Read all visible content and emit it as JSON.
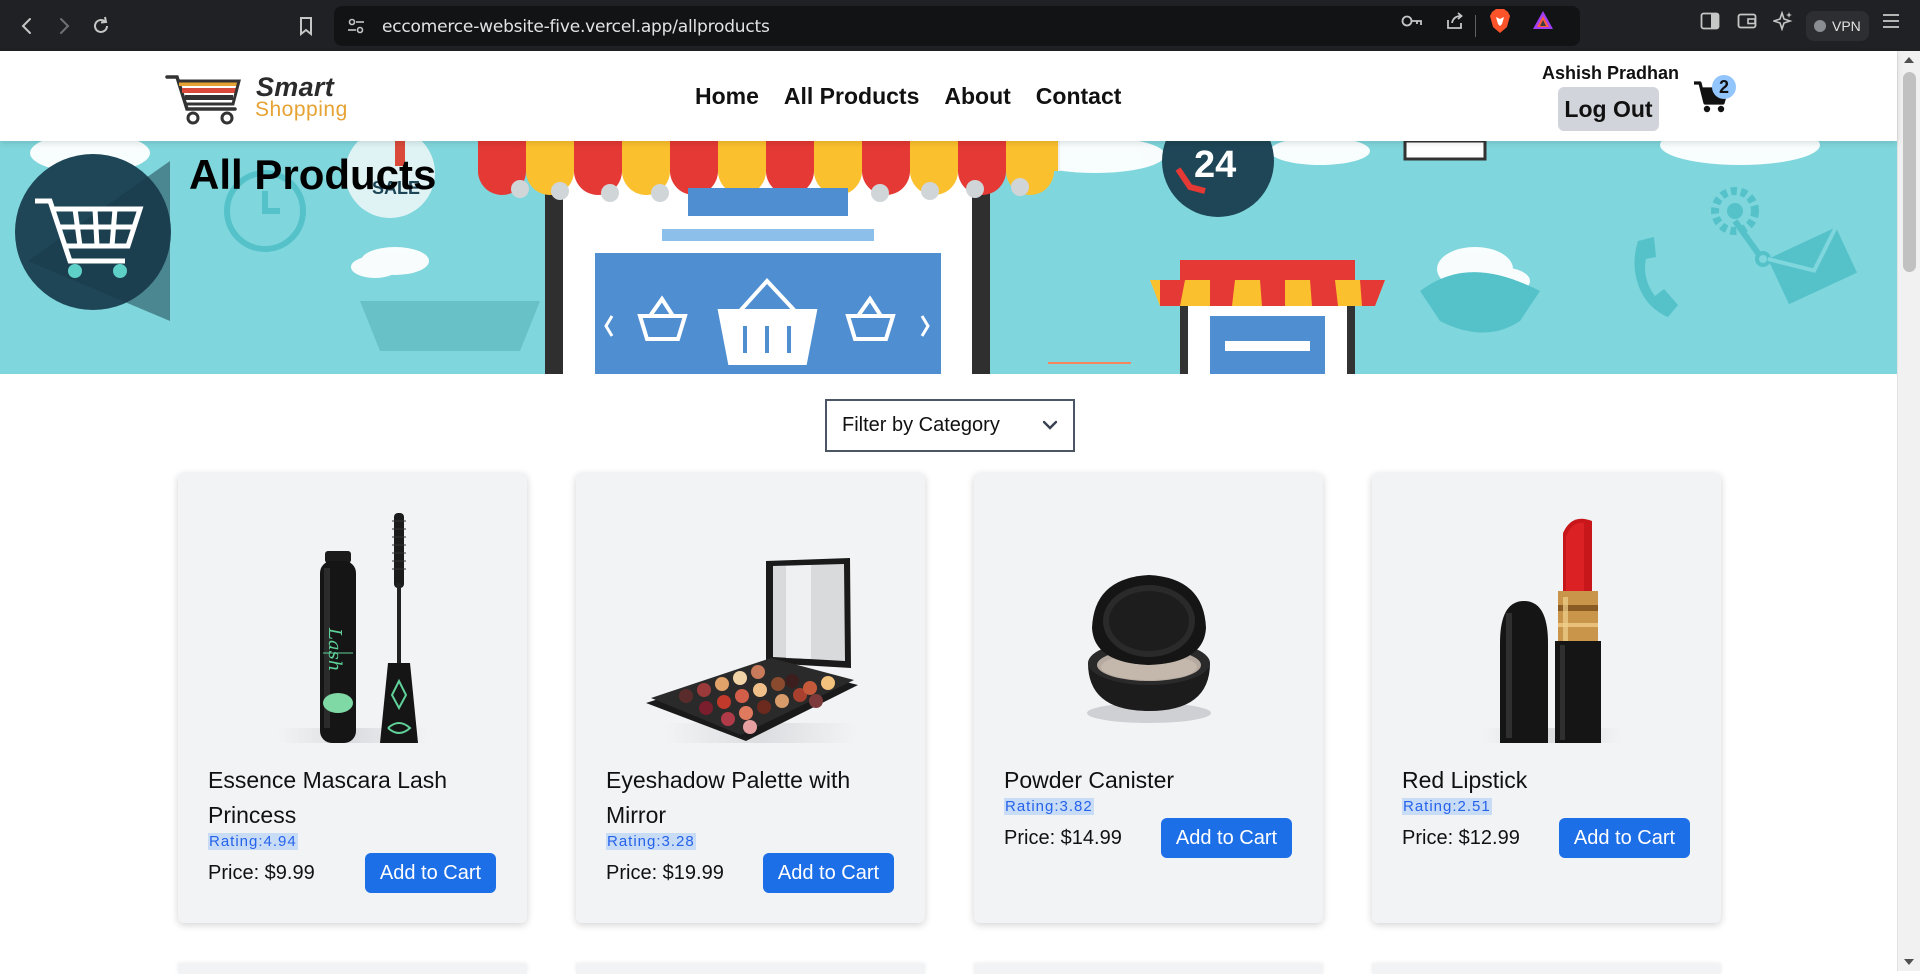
{
  "browser": {
    "url": "eccomerce-website-five.vercel.app/allproducts",
    "vpn_label": "VPN",
    "icons": [
      "back-icon",
      "forward-icon",
      "reload-icon",
      "bookmark-icon",
      "site-settings-icon",
      "password-key-icon",
      "share-icon",
      "brave-shields-icon",
      "brave-rewards-icon",
      "sidebar-icon",
      "wallet-icon",
      "leo-ai-icon",
      "menu-icon"
    ]
  },
  "header": {
    "logo": {
      "brand_top": "Smart",
      "brand_bottom": "Shopping"
    },
    "nav": [
      {
        "label": "Home"
      },
      {
        "label": "All Products"
      },
      {
        "label": "About"
      },
      {
        "label": "Contact"
      }
    ],
    "user_name": "Ashish Pradhan",
    "logout_label": "Log Out",
    "cart_count": "2"
  },
  "hero": {
    "title": "All Products",
    "sale_label": "SALE",
    "support_label": "24",
    "background_color": "#7fd6dc"
  },
  "filter": {
    "selected": "Filter by Category"
  },
  "products": [
    {
      "name": "Essence Mascara Lash Princess",
      "rating": "Rating:4.94",
      "price": "Price: $9.99",
      "button": "Add to Cart"
    },
    {
      "name": "Eyeshadow Palette with Mirror",
      "rating": "Rating:3.28",
      "price": "Price: $19.99",
      "button": "Add to Cart"
    },
    {
      "name": "Powder Canister",
      "rating": "Rating:3.82",
      "price": "Price: $14.99",
      "button": "Add to Cart"
    },
    {
      "name": "Red Lipstick",
      "rating": "Rating:2.51",
      "price": "Price: $12.99",
      "button": "Add to Cart"
    }
  ],
  "colors": {
    "accent_button": "#1d6fe8",
    "rating_text": "#2563eb",
    "card_bg": "#f2f3f5"
  }
}
